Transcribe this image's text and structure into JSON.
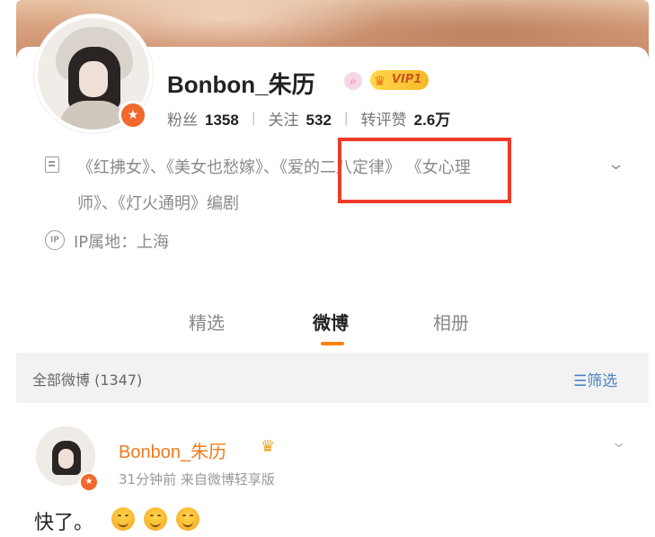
{
  "profile": {
    "name": "Bonbon_朱历",
    "vip_label": "VIP1",
    "stats": [
      {
        "label": "粉丝",
        "value": "1358"
      },
      {
        "label": "关注",
        "value": "532"
      },
      {
        "label": "转评赞",
        "value": "2.6万"
      }
    ],
    "bio_line1": "《红拂女》、《美女也愁嫁》、《爱的二八定律》 《女心理",
    "bio_line2": "师》、《灯火通明》编剧",
    "ip_icon_text": "IP",
    "ip_location": "IP属地：上海"
  },
  "tabs": [
    "精选",
    "微博",
    "相册"
  ],
  "active_tab": "微博",
  "filter": {
    "all_label": "全部微博 (1347)",
    "filter_label": "筛选"
  },
  "post": {
    "author": "Bonbon_朱历",
    "meta": "31分钟前  来自微博轻享版",
    "text": "快了。",
    "emoji_count": 3
  },
  "colors": {
    "accent": "#ff8200",
    "highlight_box": "#ee3a27",
    "link": "#4c84c4",
    "author_name": "#f07b1d"
  },
  "icons": [
    "document-icon",
    "ip-icon",
    "chevron-down-icon",
    "filter-icon",
    "crown-icon",
    "verified-icon",
    "smile-emoji-icon"
  ]
}
